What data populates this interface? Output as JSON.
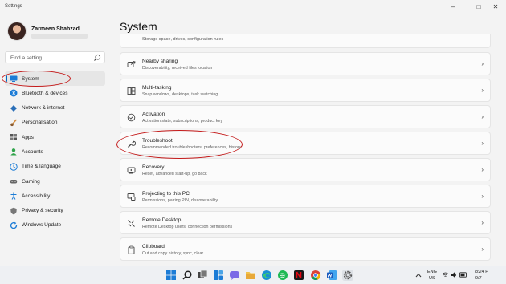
{
  "window": {
    "title": "Settings",
    "controls": [
      "–",
      "□",
      "✕"
    ]
  },
  "user": {
    "name": "Zarmeen Shahzad"
  },
  "search": {
    "placeholder": "Find a setting",
    "icon": "search-icon"
  },
  "sidebar": {
    "items": [
      {
        "label": "System",
        "icon": "monitor-icon",
        "active": true
      },
      {
        "label": "Bluetooth & devices",
        "icon": "bluetooth-icon"
      },
      {
        "label": "Network & internet",
        "icon": "wifi-diamond-icon"
      },
      {
        "label": "Personalisation",
        "icon": "brush-icon"
      },
      {
        "label": "Apps",
        "icon": "apps-grid-icon"
      },
      {
        "label": "Accounts",
        "icon": "person-icon"
      },
      {
        "label": "Time & language",
        "icon": "globe-clock-icon"
      },
      {
        "label": "Gaming",
        "icon": "gamepad-icon"
      },
      {
        "label": "Accessibility",
        "icon": "accessibility-icon"
      },
      {
        "label": "Privacy & security",
        "icon": "shield-icon"
      },
      {
        "label": "Windows Update",
        "icon": "update-icon"
      }
    ]
  },
  "main": {
    "title": "System",
    "partial_subtitle": "Storage space, drives, configuration rules",
    "cards": [
      {
        "title": "Nearby sharing",
        "subtitle": "Discoverability, received files location",
        "icon": "share-icon"
      },
      {
        "title": "Multi-tasking",
        "subtitle": "Snap windows, desktops, task switching",
        "icon": "multitask-icon"
      },
      {
        "title": "Activation",
        "subtitle": "Activation state, subscriptions, product key",
        "icon": "check-circle-icon"
      },
      {
        "title": "Troubleshoot",
        "subtitle": "Recommended troubleshooters, preferences, history",
        "icon": "wrench-icon"
      },
      {
        "title": "Recovery",
        "subtitle": "Reset, advanced start-up, go back",
        "icon": "recovery-icon"
      },
      {
        "title": "Projecting to this PC",
        "subtitle": "Permissions, pairing PIN, discoverability",
        "icon": "project-icon"
      },
      {
        "title": "Remote Desktop",
        "subtitle": "Remote Desktop users, connection permissions",
        "icon": "remote-desktop-icon"
      },
      {
        "title": "Clipboard",
        "subtitle": "Cut and copy history, sync, clear",
        "icon": "clipboard-icon"
      }
    ]
  },
  "taskbar": {
    "language": "ENG",
    "region": "US",
    "time": "8:24 P",
    "date": "9/7"
  },
  "colors": {
    "accent": "#0067c0",
    "annotation": "#c41b1b"
  }
}
